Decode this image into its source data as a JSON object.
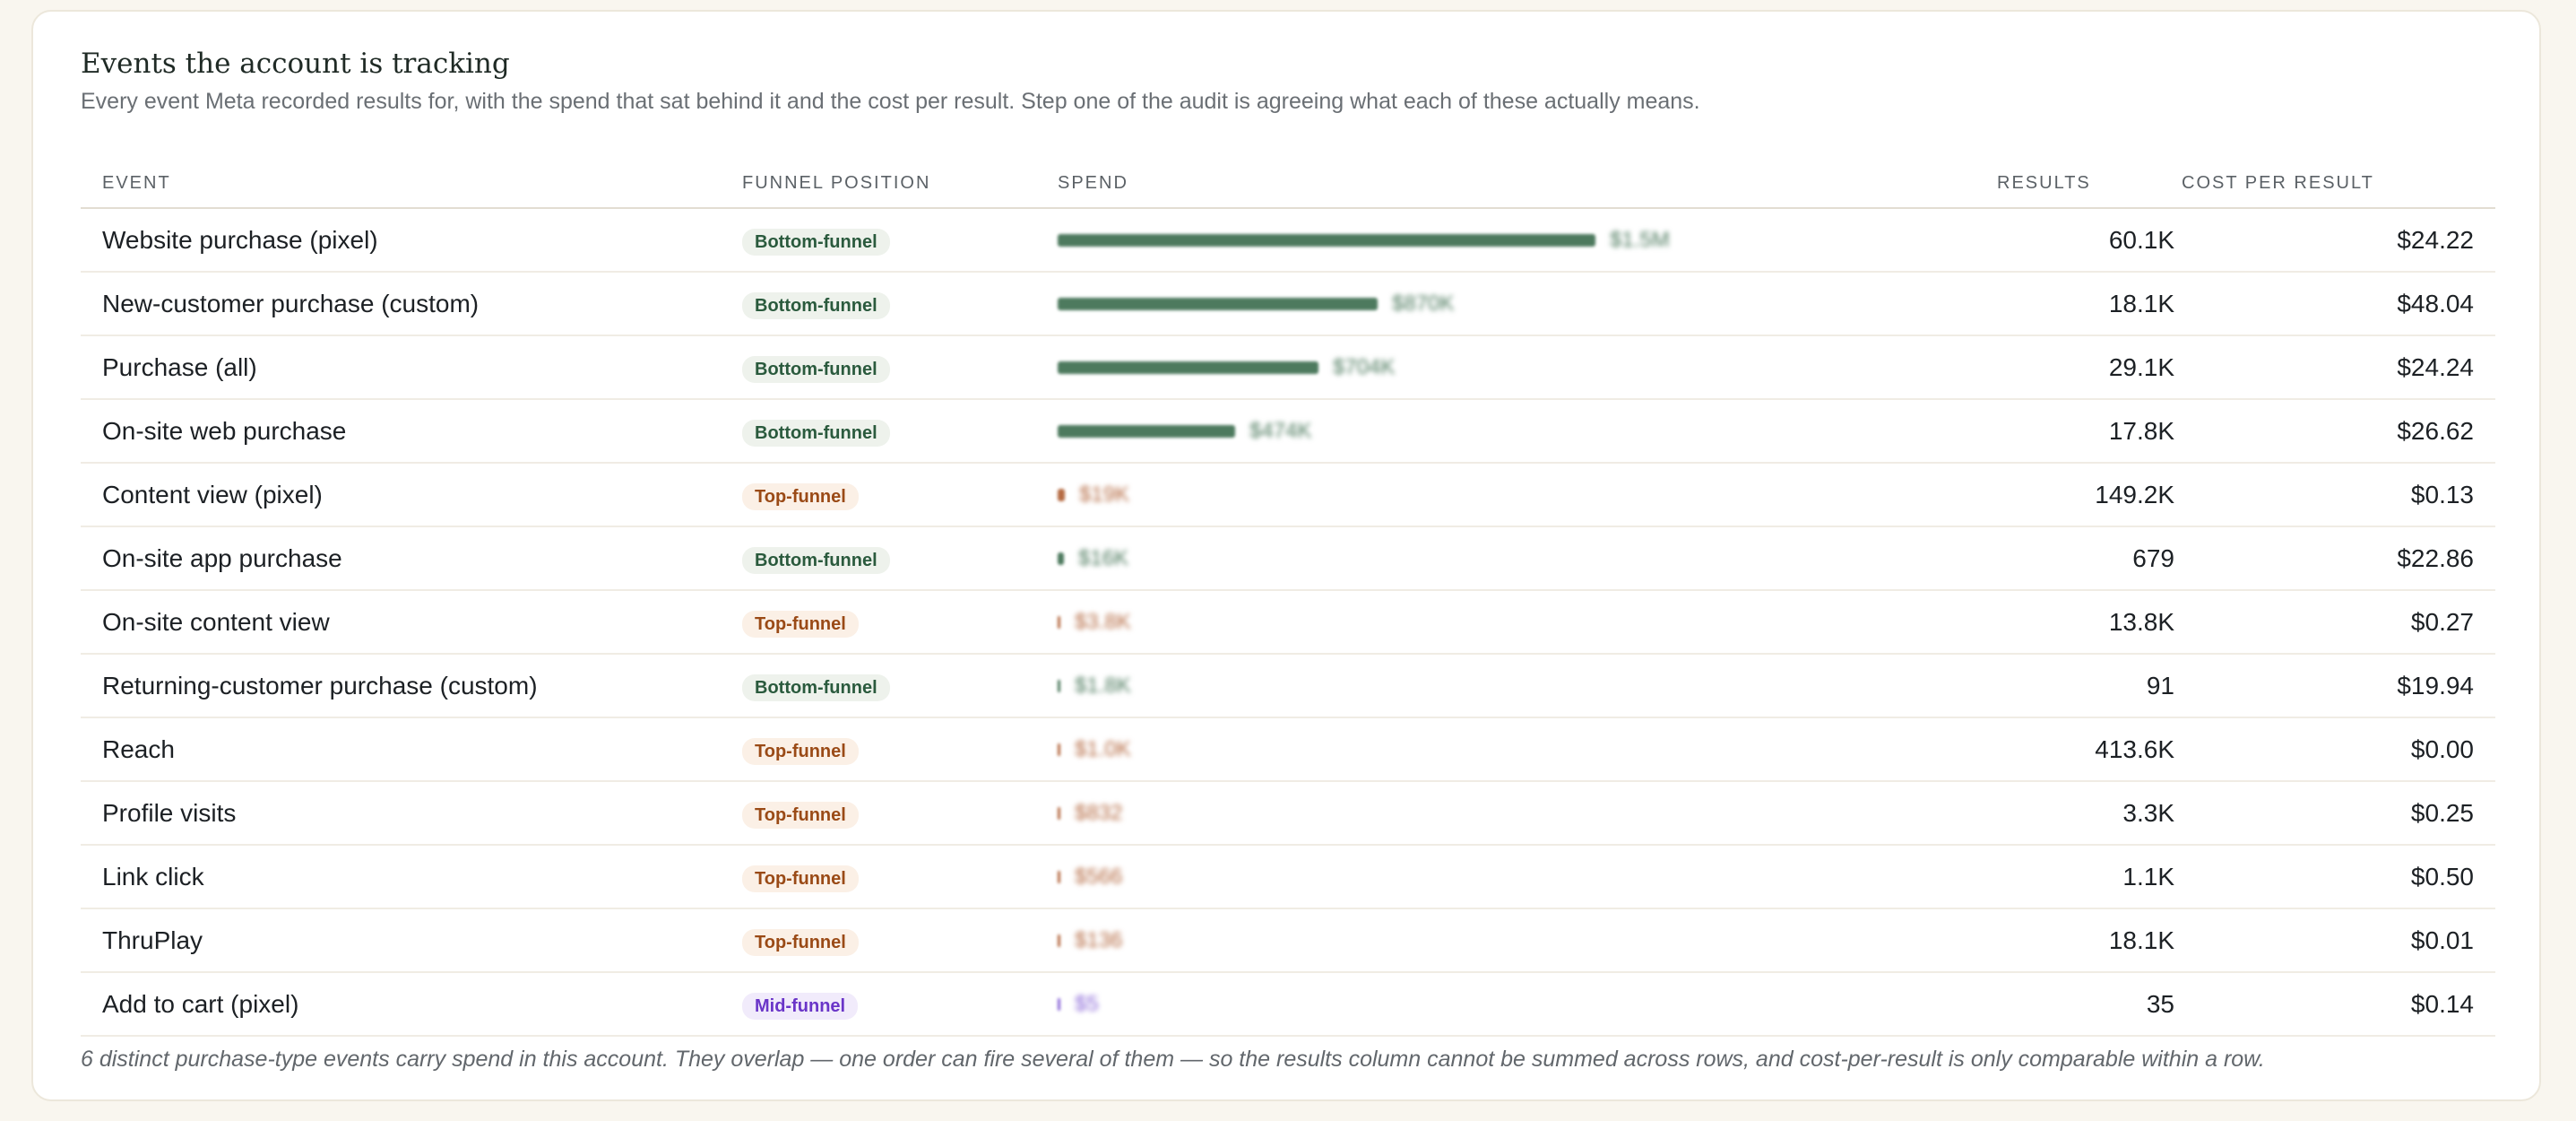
{
  "header": {
    "title": "Events the account is tracking",
    "subtitle": "Every event Meta recorded results for, with the spend that sat behind it and the cost per result. Step one of the audit is agreeing what each of these actually means."
  },
  "table": {
    "columns": [
      "EVENT",
      "FUNNEL POSITION",
      "SPEND",
      "RESULTS",
      "COST PER RESULT"
    ],
    "rows": [
      {
        "event": "Website purchase (pixel)",
        "funnel": "Bottom-funnel",
        "funnel_type": "bottom",
        "spend": "$1.5M",
        "spend_share": 1.0,
        "results": "60.1K",
        "cpr": "$24.22"
      },
      {
        "event": "New-customer purchase (custom)",
        "funnel": "Bottom-funnel",
        "funnel_type": "bottom",
        "spend": "$870K",
        "spend_share": 0.595,
        "results": "18.1K",
        "cpr": "$48.04"
      },
      {
        "event": "Purchase (all)",
        "funnel": "Bottom-funnel",
        "funnel_type": "bottom",
        "spend": "$704K",
        "spend_share": 0.485,
        "results": "29.1K",
        "cpr": "$24.24"
      },
      {
        "event": "On-site web purchase",
        "funnel": "Bottom-funnel",
        "funnel_type": "bottom",
        "spend": "$474K",
        "spend_share": 0.33,
        "results": "17.8K",
        "cpr": "$26.62"
      },
      {
        "event": "Content view (pixel)",
        "funnel": "Top-funnel",
        "funnel_type": "top",
        "spend": "$19K",
        "spend_share": 0.013,
        "results": "149.2K",
        "cpr": "$0.13"
      },
      {
        "event": "On-site app purchase",
        "funnel": "Bottom-funnel",
        "funnel_type": "bottom",
        "spend": "$16K",
        "spend_share": 0.011,
        "results": "679",
        "cpr": "$22.86"
      },
      {
        "event": "On-site content view",
        "funnel": "Top-funnel",
        "funnel_type": "top",
        "spend": "$3.8K",
        "spend_share": 0.003,
        "results": "13.8K",
        "cpr": "$0.27"
      },
      {
        "event": "Returning-customer purchase (custom)",
        "funnel": "Bottom-funnel",
        "funnel_type": "bottom",
        "spend": "$1.8K",
        "spend_share": 0.002,
        "results": "91",
        "cpr": "$19.94"
      },
      {
        "event": "Reach",
        "funnel": "Top-funnel",
        "funnel_type": "top",
        "spend": "$1.0K",
        "spend_share": 0.001,
        "results": "413.6K",
        "cpr": "$0.00"
      },
      {
        "event": "Profile visits",
        "funnel": "Top-funnel",
        "funnel_type": "top",
        "spend": "$832",
        "spend_share": 0.001,
        "results": "3.3K",
        "cpr": "$0.25"
      },
      {
        "event": "Link click",
        "funnel": "Top-funnel",
        "funnel_type": "top",
        "spend": "$566",
        "spend_share": 0.001,
        "results": "1.1K",
        "cpr": "$0.50"
      },
      {
        "event": "ThruPlay",
        "funnel": "Top-funnel",
        "funnel_type": "top",
        "spend": "$136",
        "spend_share": 0.001,
        "results": "18.1K",
        "cpr": "$0.01"
      },
      {
        "event": "Add to cart (pixel)",
        "funnel": "Mid-funnel",
        "funnel_type": "mid",
        "spend": "$5",
        "spend_share": 0.0,
        "results": "35",
        "cpr": "$0.14"
      }
    ]
  },
  "footnote": "6 distinct purchase-type events carry spend in this account. They overlap — one order can fire several of them — so the results column cannot be summed across rows, and cost-per-result is only comparable within a row.",
  "colors": {
    "bottom": "#4d7a5e",
    "top": "#b56b43",
    "mid": "#8a67d8"
  }
}
